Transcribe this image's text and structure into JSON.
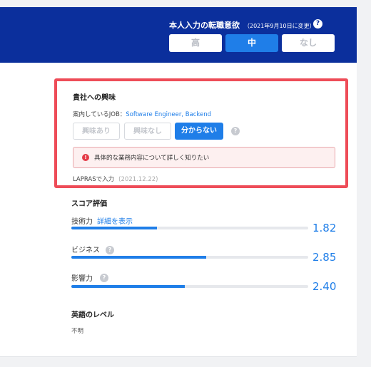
{
  "header": {
    "title": "本人入力の転職意欲",
    "changed_note": "（2021年9月10日に変更）",
    "help_glyph": "?",
    "options": [
      {
        "label": "高",
        "selected": false
      },
      {
        "label": "中",
        "selected": true
      },
      {
        "label": "なし",
        "selected": false
      }
    ]
  },
  "interest": {
    "title": "貴社への興味",
    "job_prefix": "案内しているJOB：",
    "job_link": "Software Engineer, Backend",
    "choices": [
      {
        "label": "興味あり",
        "selected": false
      },
      {
        "label": "興味なし",
        "selected": false
      },
      {
        "label": "分からない",
        "selected": true
      }
    ],
    "help_glyph": "?",
    "notice_glyph": "!",
    "notice": "具体的な業務内容について詳しく知りたい",
    "source": "LAPRASで入力",
    "source_date": "(2021.12.22)"
  },
  "scores": {
    "title": "スコア評価",
    "detail_link": "詳細を表示",
    "items": [
      {
        "label": "技術力",
        "value": "1.82",
        "fill_percent": 36
      },
      {
        "label": "ビジネス",
        "value": "2.85",
        "fill_percent": 57
      },
      {
        "label": "影響力",
        "value": "2.40",
        "fill_percent": 48
      }
    ]
  },
  "english": {
    "title": "英語のレベル",
    "value": "不明"
  },
  "colors": {
    "header_bg": "#0b2f9c",
    "accent": "#1f7ee8",
    "highlight_border": "#ee4c58",
    "error": "#e43a46"
  }
}
